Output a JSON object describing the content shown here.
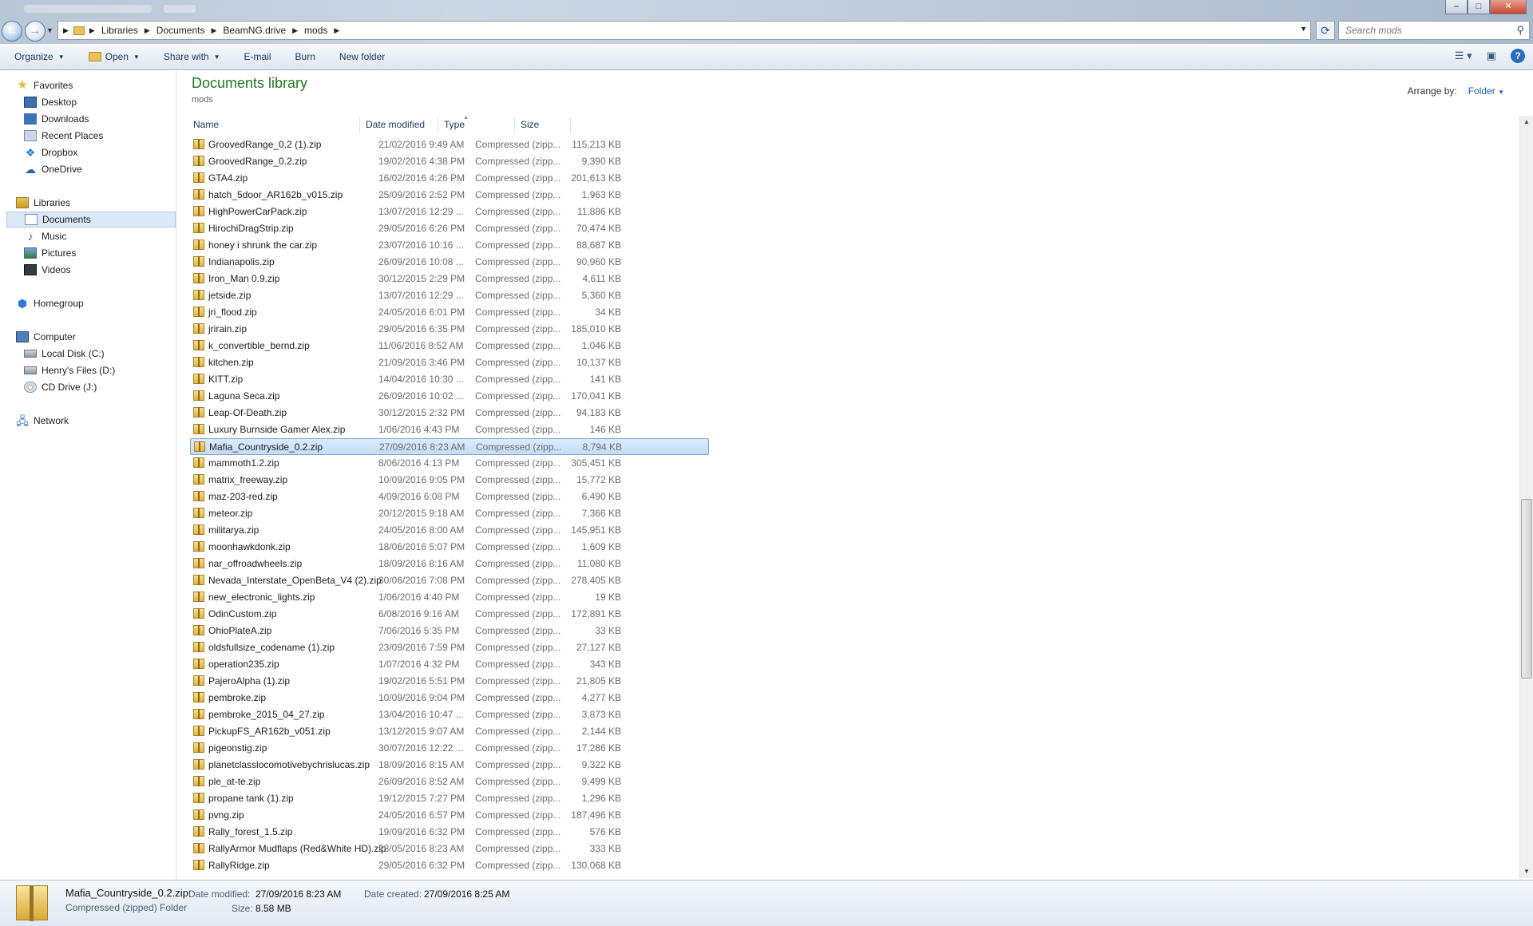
{
  "address": {
    "crumbs": [
      "Libraries",
      "Documents",
      "BeamNG.drive",
      "mods"
    ],
    "search_placeholder": "Search mods"
  },
  "toolbar": {
    "organize": "Organize",
    "open": "Open",
    "share_with": "Share with",
    "email": "E-mail",
    "burn": "Burn",
    "new_folder": "New folder"
  },
  "nav": {
    "favorites": "Favorites",
    "desktop": "Desktop",
    "downloads": "Downloads",
    "recent": "Recent Places",
    "dropbox": "Dropbox",
    "onedrive": "OneDrive",
    "libraries": "Libraries",
    "documents": "Documents",
    "music": "Music",
    "pictures": "Pictures",
    "videos": "Videos",
    "homegroup": "Homegroup",
    "computer": "Computer",
    "local_disk": "Local Disk (C:)",
    "henrys_files": "Henry's Files (D:)",
    "cd_drive": "CD Drive (J:)",
    "network": "Network"
  },
  "header": {
    "title": "Documents library",
    "subtitle": "mods",
    "arrange_label": "Arrange by:",
    "arrange_value": "Folder"
  },
  "columns": {
    "name": "Name",
    "date": "Date modified",
    "type": "Type",
    "size": "Size"
  },
  "files": [
    {
      "name": "GroovedRange_0.2 (1).zip",
      "date": "21/02/2016 9:49 AM",
      "type": "Compressed (zipp...",
      "size": "115,213 KB"
    },
    {
      "name": "GroovedRange_0.2.zip",
      "date": "19/02/2016 4:38 PM",
      "type": "Compressed (zipp...",
      "size": "9,390 KB"
    },
    {
      "name": "GTA4.zip",
      "date": "16/02/2016 4:26 PM",
      "type": "Compressed (zipp...",
      "size": "201,613 KB"
    },
    {
      "name": "hatch_5door_AR162b_v015.zip",
      "date": "25/09/2016 2:52 PM",
      "type": "Compressed (zipp...",
      "size": "1,963 KB"
    },
    {
      "name": "HighPowerCarPack.zip",
      "date": "13/07/2016 12:29 ...",
      "type": "Compressed (zipp...",
      "size": "11,886 KB"
    },
    {
      "name": "HirochiDragStrip.zip",
      "date": "29/05/2016 6:26 PM",
      "type": "Compressed (zipp...",
      "size": "70,474 KB"
    },
    {
      "name": "honey i shrunk the car.zip",
      "date": "23/07/2016 10:16 ...",
      "type": "Compressed (zipp...",
      "size": "88,687 KB"
    },
    {
      "name": "Indianapolis.zip",
      "date": "26/09/2016 10:08 ...",
      "type": "Compressed (zipp...",
      "size": "90,960 KB"
    },
    {
      "name": "Iron_Man 0.9.zip",
      "date": "30/12/2015 2:29 PM",
      "type": "Compressed (zipp...",
      "size": "4,611 KB"
    },
    {
      "name": "jetside.zip",
      "date": "13/07/2016 12:29 ...",
      "type": "Compressed (zipp...",
      "size": "5,360 KB"
    },
    {
      "name": "jri_flood.zip",
      "date": "24/05/2016 6:01 PM",
      "type": "Compressed (zipp...",
      "size": "34 KB"
    },
    {
      "name": "jrirain.zip",
      "date": "29/05/2016 6:35 PM",
      "type": "Compressed (zipp...",
      "size": "185,010 KB"
    },
    {
      "name": "k_convertible_bernd.zip",
      "date": "11/06/2016 8:52 AM",
      "type": "Compressed (zipp...",
      "size": "1,046 KB"
    },
    {
      "name": "kitchen.zip",
      "date": "21/09/2016 3:46 PM",
      "type": "Compressed (zipp...",
      "size": "10,137 KB"
    },
    {
      "name": "KITT.zip",
      "date": "14/04/2016 10:30 ...",
      "type": "Compressed (zipp...",
      "size": "141 KB"
    },
    {
      "name": "Laguna Seca.zip",
      "date": "26/09/2016 10:02 ...",
      "type": "Compressed (zipp...",
      "size": "170,041 KB"
    },
    {
      "name": "Leap-Of-Death.zip",
      "date": "30/12/2015 2:32 PM",
      "type": "Compressed (zipp...",
      "size": "94,183 KB"
    },
    {
      "name": "Luxury Burnside Gamer Alex.zip",
      "date": "1/06/2016 4:43 PM",
      "type": "Compressed (zipp...",
      "size": "146 KB"
    },
    {
      "name": "Mafia_Countryside_0.2.zip",
      "date": "27/09/2016 8:23 AM",
      "type": "Compressed (zipp...",
      "size": "8,794 KB",
      "selected": true
    },
    {
      "name": "mammoth1.2.zip",
      "date": "8/06/2016 4:13 PM",
      "type": "Compressed (zipp...",
      "size": "305,451 KB"
    },
    {
      "name": "matrix_freeway.zip",
      "date": "10/09/2016 9:05 PM",
      "type": "Compressed (zipp...",
      "size": "15,772 KB"
    },
    {
      "name": "maz-203-red.zip",
      "date": "4/09/2016 6:08 PM",
      "type": "Compressed (zipp...",
      "size": "6,490 KB"
    },
    {
      "name": "meteor.zip",
      "date": "20/12/2015 9:18 AM",
      "type": "Compressed (zipp...",
      "size": "7,366 KB"
    },
    {
      "name": "militarya.zip",
      "date": "24/05/2016 8:00 AM",
      "type": "Compressed (zipp...",
      "size": "145,951 KB"
    },
    {
      "name": "moonhawkdonk.zip",
      "date": "18/06/2016 5:07 PM",
      "type": "Compressed (zipp...",
      "size": "1,609 KB"
    },
    {
      "name": "nar_offroadwheels.zip",
      "date": "18/09/2016 8:16 AM",
      "type": "Compressed (zipp...",
      "size": "11,080 KB"
    },
    {
      "name": "Nevada_Interstate_OpenBeta_V4 (2).zip",
      "date": "30/06/2016 7:08 PM",
      "type": "Compressed (zipp...",
      "size": "278,405 KB"
    },
    {
      "name": "new_electronic_lights.zip",
      "date": "1/06/2016 4:40 PM",
      "type": "Compressed (zipp...",
      "size": "19 KB"
    },
    {
      "name": "OdinCustom.zip",
      "date": "6/08/2016 9:16 AM",
      "type": "Compressed (zipp...",
      "size": "172,891 KB"
    },
    {
      "name": "OhioPlateA.zip",
      "date": "7/06/2016 5:35 PM",
      "type": "Compressed (zipp...",
      "size": "33 KB"
    },
    {
      "name": "oldsfullsize_codename (1).zip",
      "date": "23/09/2016 7:59 PM",
      "type": "Compressed (zipp...",
      "size": "27,127 KB"
    },
    {
      "name": "operation235.zip",
      "date": "1/07/2016 4:32 PM",
      "type": "Compressed (zipp...",
      "size": "343 KB"
    },
    {
      "name": "PajeroAlpha (1).zip",
      "date": "19/02/2016 5:51 PM",
      "type": "Compressed (zipp...",
      "size": "21,805 KB"
    },
    {
      "name": "pembroke.zip",
      "date": "10/09/2016 9:04 PM",
      "type": "Compressed (zipp...",
      "size": "4,277 KB"
    },
    {
      "name": "pembroke_2015_04_27.zip",
      "date": "13/04/2016 10:47 ...",
      "type": "Compressed (zipp...",
      "size": "3,873 KB"
    },
    {
      "name": "PickupFS_AR162b_v051.zip",
      "date": "13/12/2015 9:07 AM",
      "type": "Compressed (zipp...",
      "size": "2,144 KB"
    },
    {
      "name": "pigeonstig.zip",
      "date": "30/07/2016 12:22 ...",
      "type": "Compressed (zipp...",
      "size": "17,286 KB"
    },
    {
      "name": "planetclasslocomotivebychrislucas.zip",
      "date": "18/09/2016 8:15 AM",
      "type": "Compressed (zipp...",
      "size": "9,322 KB"
    },
    {
      "name": "ple_at-te.zip",
      "date": "26/09/2016 8:52 AM",
      "type": "Compressed (zipp...",
      "size": "9,499 KB"
    },
    {
      "name": "propane tank (1).zip",
      "date": "19/12/2015 7:27 PM",
      "type": "Compressed (zipp...",
      "size": "1,296 KB"
    },
    {
      "name": "pvng.zip",
      "date": "24/05/2016 6:57 PM",
      "type": "Compressed (zipp...",
      "size": "187,496 KB"
    },
    {
      "name": "Rally_forest_1.5.zip",
      "date": "19/09/2016 6:32 PM",
      "type": "Compressed (zipp...",
      "size": "576 KB"
    },
    {
      "name": "RallyArmor Mudflaps (Red&White HD).zip",
      "date": "28/05/2016 8:23 AM",
      "type": "Compressed (zipp...",
      "size": "333 KB"
    },
    {
      "name": "RallyRidge.zip",
      "date": "29/05/2016 6:32 PM",
      "type": "Compressed (zipp...",
      "size": "130,068 KB"
    }
  ],
  "details": {
    "name": "Mafia_Countryside_0.2.zip",
    "type": "Compressed (zipped) Folder",
    "modified_label": "Date modified:",
    "modified_value": "27/09/2016 8:23 AM",
    "created_label": "Date created:",
    "created_value": "27/09/2016 8:25 AM",
    "size_label": "Size:",
    "size_value": "8.58 MB"
  }
}
